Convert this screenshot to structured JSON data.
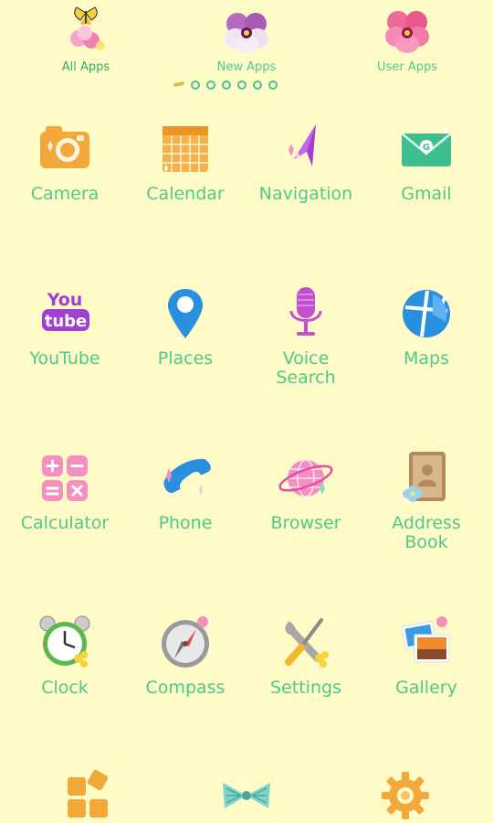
{
  "tabs": [
    {
      "label": "All Apps",
      "icon": "butterfly-flower-icon",
      "active": true
    },
    {
      "label": "New Apps",
      "icon": "purple-pansy-icon",
      "active": false
    },
    {
      "label": "User Apps",
      "icon": "pink-pansy-icon",
      "active": false
    }
  ],
  "pager": {
    "current": 1,
    "total": 7
  },
  "apps": [
    {
      "label": "Camera",
      "icon": "camera-icon"
    },
    {
      "label": "Calendar",
      "icon": "calendar-icon"
    },
    {
      "label": "Navigation",
      "icon": "navigation-arrow-icon"
    },
    {
      "label": "Gmail",
      "icon": "envelope-icon"
    },
    {
      "label": "YouTube",
      "icon": "youtube-icon"
    },
    {
      "label": "Places",
      "icon": "map-pin-icon"
    },
    {
      "label": "Voice\nSearch",
      "icon": "microphone-icon"
    },
    {
      "label": "Maps",
      "icon": "map-globe-icon"
    },
    {
      "label": "Calculator",
      "icon": "calculator-icon"
    },
    {
      "label": "Phone",
      "icon": "phone-handset-icon"
    },
    {
      "label": "Browser",
      "icon": "globe-icon"
    },
    {
      "label": "Address\nBook",
      "icon": "address-book-icon"
    },
    {
      "label": "Clock",
      "icon": "alarm-clock-icon"
    },
    {
      "label": "Compass",
      "icon": "compass-icon"
    },
    {
      "label": "Settings",
      "icon": "wrench-screwdriver-icon"
    },
    {
      "label": "Gallery",
      "icon": "photos-icon"
    }
  ],
  "dock": [
    {
      "icon": "app-drawer-icon"
    },
    {
      "icon": "ribbon-bow-icon"
    },
    {
      "icon": "gear-icon"
    }
  ],
  "colors": {
    "background": "#fffbc6",
    "label": "#4ec88f",
    "accent_orange": "#f0a93a",
    "accent_pink": "#e94ca6",
    "accent_blue": "#2b8fe0"
  }
}
